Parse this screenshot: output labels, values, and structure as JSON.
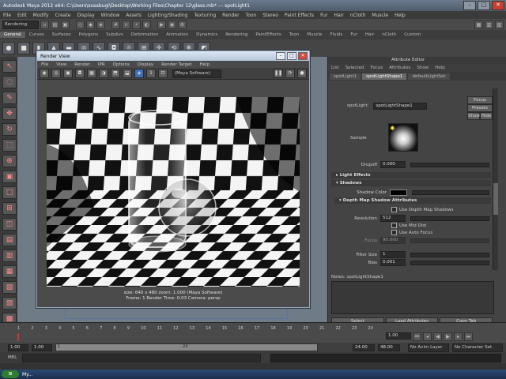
{
  "window": {
    "title": "Autodesk Maya 2012 x64: C:\\Users\\ssaabugi\\Desktop\\Working Files\\Chapter 12\\glass.mb* --- spotLight1"
  },
  "menubar": [
    "File",
    "Edit",
    "Modify",
    "Create",
    "Display",
    "Window",
    "Assets",
    "Lighting/Shading",
    "Texturing",
    "Render",
    "Toon",
    "Stereo",
    "Paint Effects",
    "Fur",
    "Hair",
    "nCloth",
    "Muscle",
    "Help"
  ],
  "status_line": {
    "menu_set": "Rendering"
  },
  "shelf_tabs": [
    "General",
    "Curves",
    "Surfaces",
    "Polygons",
    "Subdivs",
    "Deformation",
    "Animation",
    "Dynamics",
    "Rendering",
    "PaintEffects",
    "Toon",
    "Muscle",
    "Fluids",
    "Fur",
    "Hair",
    "nCloth",
    "Custom"
  ],
  "shelf_active": "General",
  "render_view": {
    "title": "Render View",
    "menu": [
      "File",
      "View",
      "Render",
      "IPR",
      "Options",
      "Display",
      "Render Target",
      "Help"
    ],
    "camera_dropdown": "(Maya Software)",
    "info_line1": "size: 640 x 480 zoom: 1.000    (Maya Software)",
    "info_line2": "Frame: 1      Render Time: 0:03      Camera: persp"
  },
  "attribute_editor": {
    "title": "Attribute Editor",
    "menu": [
      "List",
      "Selected",
      "Focus",
      "Attributes",
      "Show",
      "Help"
    ],
    "tabs": [
      "spotLight1",
      "spotLightShape1",
      "defaultLightSet"
    ],
    "active_tab": "spotLightShape1",
    "node_label": "spotLight:",
    "node_name": "spotLightShape1",
    "focus_btn": "Focus",
    "presets_btn": "Presets",
    "show_btn": "Show",
    "hide_btn": "Hide",
    "sample_label": "Sample",
    "dropoff_label": "Dropoff",
    "dropoff_value": "0.000",
    "sections": {
      "light_effects": "Light Effects",
      "shadows": "Shadows",
      "depth_map": "Depth Map Shadow Attributes"
    },
    "shadow_color_label": "Shadow Color",
    "use_depth_map": "Use Depth Map Shadows",
    "resolution_label": "Resolution",
    "resolution_value": "512",
    "use_mid_dist": "Use Mid Dist",
    "use_auto_focus": "Use Auto Focus",
    "focus_label": "Focus",
    "focus_value": "90.000",
    "filter_size_label": "Filter Size",
    "filter_size_value": "1",
    "bias_label": "Bias",
    "bias_value": "0.001",
    "notes": "Notes:  spotLightShape1",
    "buttons": [
      "Select",
      "Load Attributes",
      "Copy Tab"
    ]
  },
  "timeline": {
    "ticks": [
      "1",
      "2",
      "3",
      "4",
      "5",
      "6",
      "7",
      "8",
      "9",
      "10",
      "11",
      "12",
      "13",
      "14",
      "15",
      "16",
      "17",
      "18",
      "19",
      "20",
      "21",
      "22",
      "23",
      "24"
    ],
    "current_frame": "1.00",
    "range_start": "1.00",
    "range_start2": "1.00",
    "range_mid": "1",
    "range_mid2": "24",
    "range_end": "24.00",
    "range_end2": "48.00",
    "anim_layer": "No Anim Layer",
    "char_set": "No Character Set"
  },
  "command_line": {
    "label": "MEL"
  },
  "taskbar": {
    "start": "My..."
  }
}
